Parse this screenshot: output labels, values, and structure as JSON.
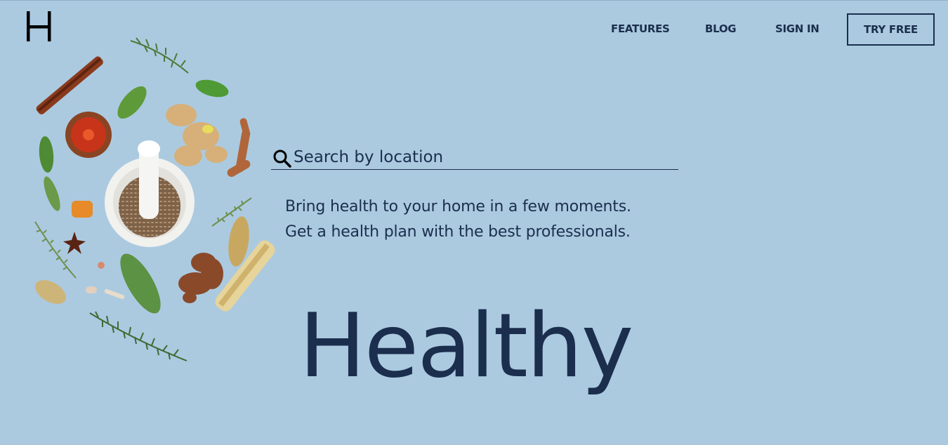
{
  "brand": {
    "logo_letter": "H"
  },
  "nav": {
    "features": "FEATURES",
    "blog": "BLOG",
    "sign_in": "SIGN IN",
    "try_free": "TRY FREE"
  },
  "search": {
    "placeholder": "Search by location",
    "icon": "search-icon"
  },
  "tagline": {
    "line1": "Bring health to your home in a few moments.",
    "line2": "Get a health plan with the best professionals."
  },
  "hero": {
    "title": "Healthy"
  },
  "colors": {
    "background": "#abcae0",
    "text": "#1b2e4d"
  }
}
